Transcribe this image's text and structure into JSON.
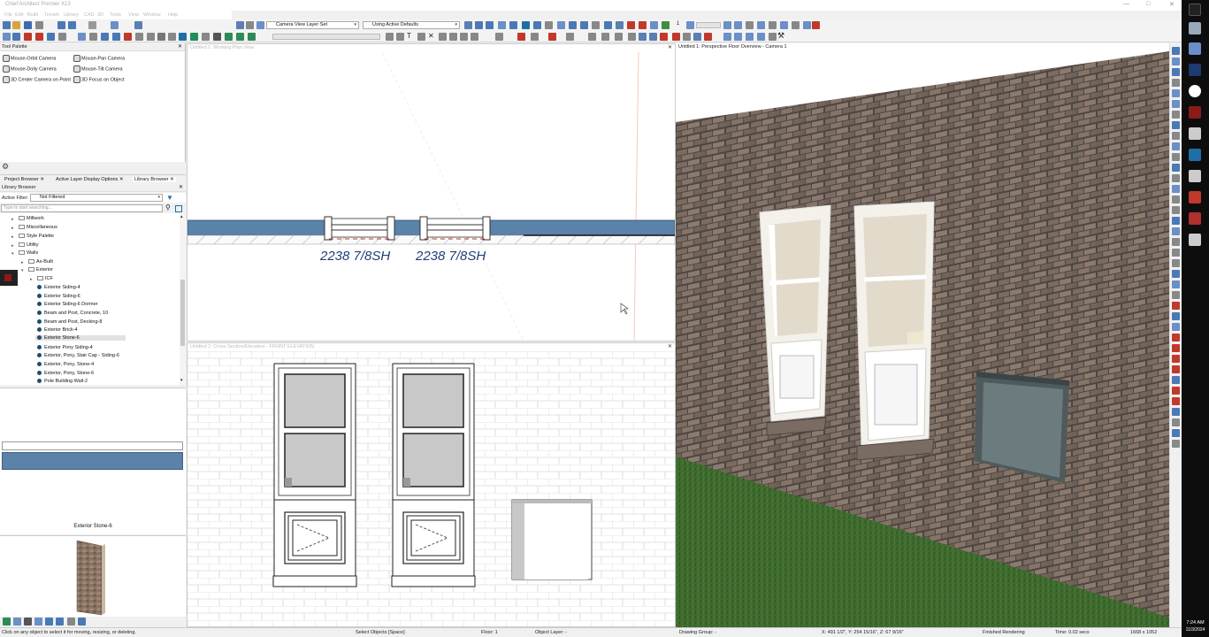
{
  "window": {
    "title": "Chief Architect Premier X13"
  },
  "menu": [
    "File",
    "Edit",
    "Build",
    "Terrain",
    "Library",
    "CAD",
    "3D",
    "Tools",
    "View",
    "Window",
    "Help"
  ],
  "toolbar": {
    "layer_set": "Camera View Layer Set",
    "defaults": "Using Active Defaults",
    "number_field": "1"
  },
  "tool_palette": {
    "title": "Tool Palette",
    "items": [
      "Mouse-Orbit Camera",
      "Mouse-Pan Camera",
      "Mouse-Dolly Camera",
      "Mouse-Tilt Camera",
      "3D Center Camera on Point",
      "3D Focus on Object"
    ]
  },
  "tabs": [
    "Project Browser",
    "Active Layer Display Options",
    "Library Browser"
  ],
  "library": {
    "title": "Library Browser",
    "filter_label": "Active Filter:",
    "filter_value": "Not Filtered",
    "search_placeholder": "Type to start searching...",
    "folders": [
      "Millwork",
      "Miscellaneous",
      "Style Palette",
      "Utility",
      "Walls",
      "As-Built",
      "Exterior",
      "ICF"
    ],
    "items": [
      "Exterior Siding-4",
      "Exterior Siding-6",
      "Exterior Siding-6 Dormer",
      "Beam and Post, Concrete, 10",
      "Beam and Post, Decking-8",
      "Exterior Brick-4",
      "Exterior Stone-6",
      "Exterior Pony Siding-4",
      "Exterior, Pony, Stair Cap - Siding-6",
      "Exterior, Pony, Stone-4",
      "Exterior, Pony, Stone-6",
      "Pole Building Wall-2"
    ],
    "selected_item": "Exterior Stone-6",
    "preview_label": "Exterior Stone-6"
  },
  "views": {
    "plan_title": "Untitled 1: Working Plan View",
    "window_label": "2238 7/8SH",
    "elevation_title": "Untitled 1: Cross Section/Elevation - FRONT ELEVATION",
    "perspective_title": "Untitled 1: Perspective Floor Overview - Camera 1"
  },
  "status": {
    "hint": "Click on any object to select it for moving, resizing, or deleting.",
    "mode": "Select Objects [Space]",
    "floor": "Floor: 1",
    "object_layer": "Object Layer: -",
    "drawing_group": "Drawing Group: -",
    "coords": "X: 491 1/2\", Y: 254 15/16\", Z: 67 9/16\"",
    "rendering": "Finished Rendering",
    "time": "Time: 0.02 secs",
    "resolution": "1668 x 1052"
  },
  "clock": {
    "time": "7:24 AM",
    "date": "11/3/2024"
  },
  "colors": {
    "brick": "#6e6158",
    "grass": "#3e6a2e",
    "wall_blue": "#5b82a8",
    "plan_label": "#1f3e78"
  }
}
